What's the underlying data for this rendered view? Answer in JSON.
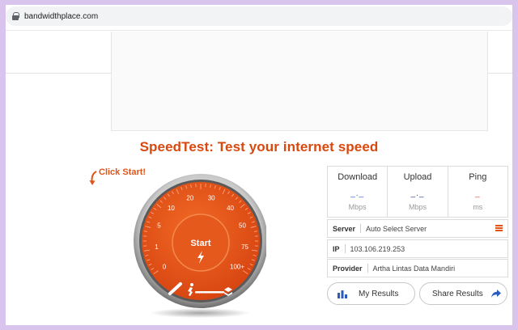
{
  "browser": {
    "url": "bandwidthplace.com"
  },
  "page": {
    "title": "SpeedTest: Test your internet speed",
    "click_start": "Click Start!"
  },
  "gauge": {
    "start_label": "Start",
    "scale": [
      "0",
      "1",
      "5",
      "10",
      "20",
      "30",
      "40",
      "50",
      "75",
      "100+"
    ]
  },
  "metrics": [
    {
      "name": "Download",
      "value": "_._",
      "unit": "Mbps"
    },
    {
      "name": "Upload",
      "value": "_._",
      "unit": "Mbps"
    },
    {
      "name": "Ping",
      "value": "_",
      "unit": "ms"
    }
  ],
  "info": {
    "server_label": "Server",
    "server_value": "Auto Select Server",
    "ip_label": "IP",
    "ip_value": "103.106.219.253",
    "provider_label": "Provider",
    "provider_value": "Artha Lintas Data Mandiri"
  },
  "actions": {
    "my_results": "My Results",
    "share_results": "Share Results"
  },
  "colors": {
    "accent": "#e0541a",
    "title": "#d9480f",
    "download": "#2c5bbf"
  }
}
